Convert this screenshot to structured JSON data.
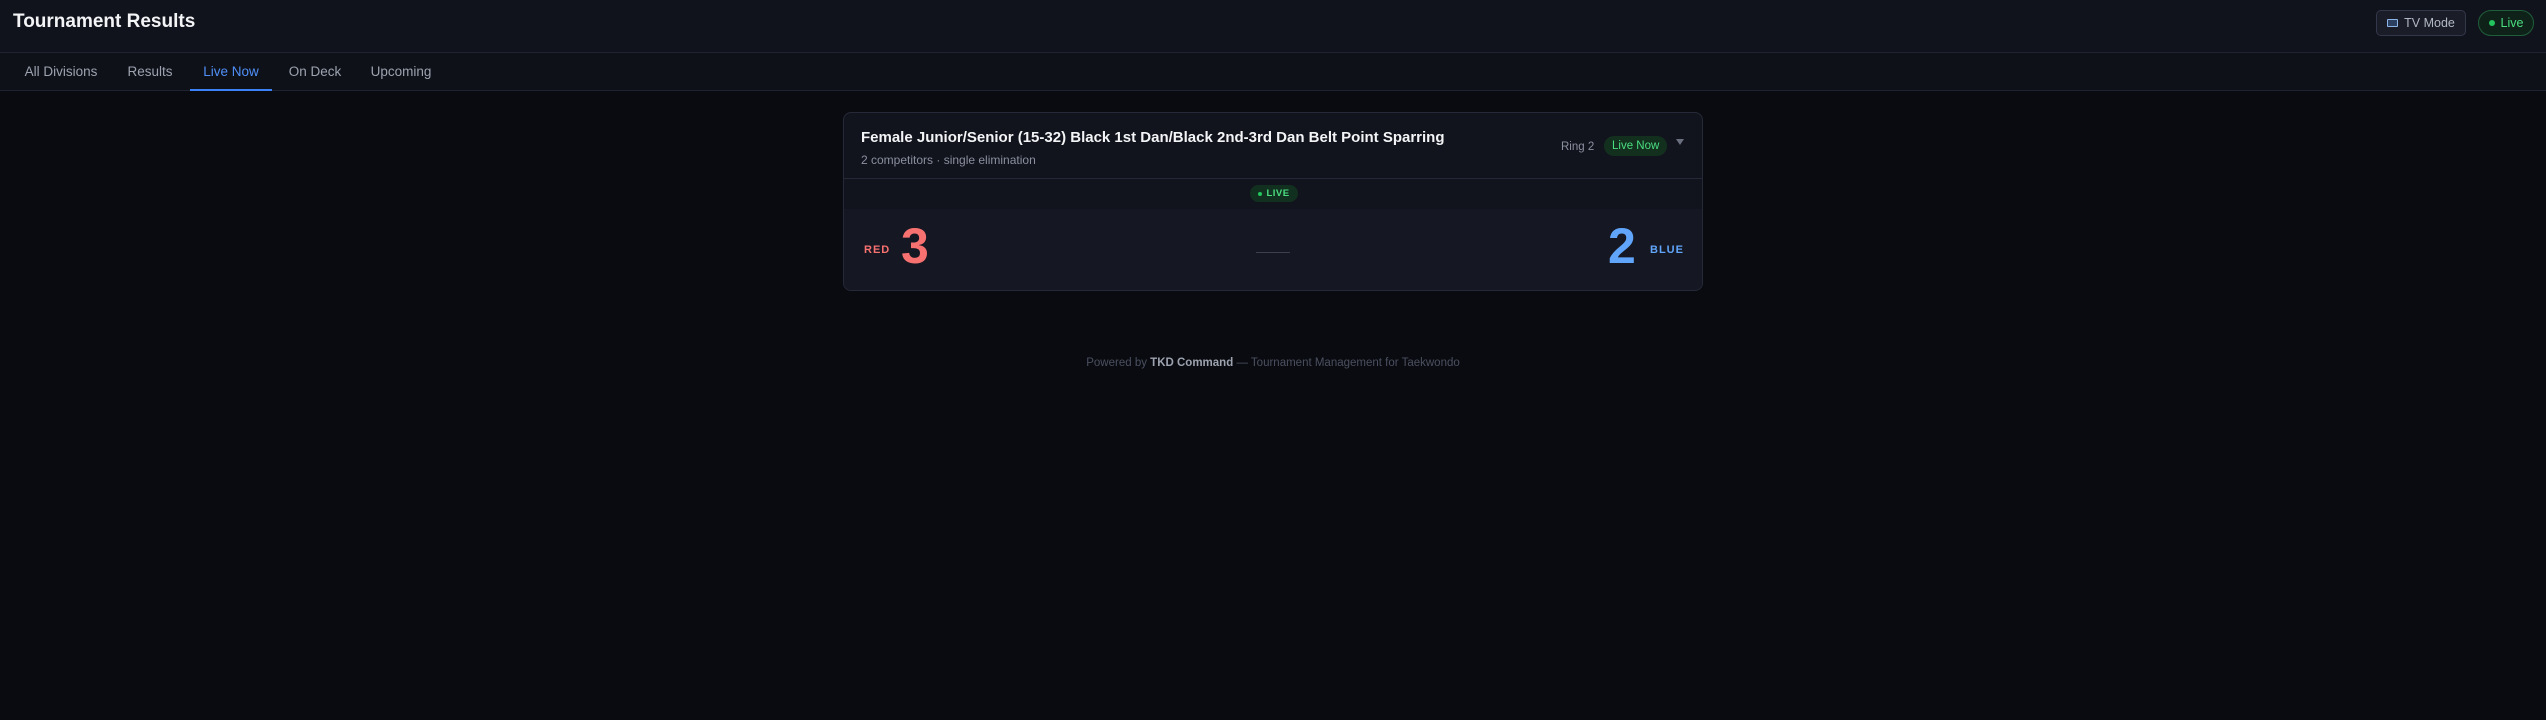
{
  "header": {
    "title": "Tournament Results",
    "tv_mode_label": "TV Mode",
    "live_label": "Live"
  },
  "tabs": [
    {
      "label": "All Divisions",
      "active": false
    },
    {
      "label": "Results",
      "active": false
    },
    {
      "label": "Live Now",
      "active": true
    },
    {
      "label": "On Deck",
      "active": false
    },
    {
      "label": "Upcoming",
      "active": false
    }
  ],
  "division": {
    "title": "Female Junior/Senior (15-32) Black 1st Dan/Black 2nd-3rd Dan Belt Point Sparring",
    "subtitle": "2 competitors · single elimination",
    "ring": "Ring 2",
    "status": "Live Now",
    "live_tag": "LIVE",
    "match": {
      "red_label": "RED",
      "red_score": "3",
      "blue_label": "BLUE",
      "blue_score": "2"
    }
  },
  "footer": {
    "prefix": "Powered by",
    "brand": "TKD Command",
    "suffix": "— Tournament Management for Taekwondo"
  },
  "colors": {
    "accent": "#3b82f6",
    "live": "#22c55e",
    "red": "#f87171",
    "blue": "#60a5fa"
  }
}
